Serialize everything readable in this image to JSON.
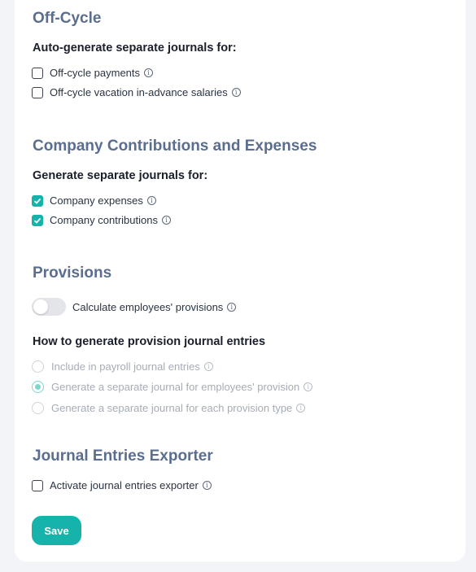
{
  "sections": {
    "off_cycle": {
      "title": "Off-Cycle",
      "subtitle": "Auto-generate separate journals for:",
      "items": [
        {
          "label": "Off-cycle payments",
          "checked": false
        },
        {
          "label": "Off-cycle vacation in-advance salaries",
          "checked": false
        }
      ]
    },
    "contributions": {
      "title": "Company Contributions and Expenses",
      "subtitle": "Generate separate journals for:",
      "items": [
        {
          "label": "Company expenses",
          "checked": true
        },
        {
          "label": "Company contributions",
          "checked": true
        }
      ]
    },
    "provisions": {
      "title": "Provisions",
      "toggle_label": "Calculate employees' provisions",
      "toggle_on": false,
      "subtitle": "How to generate provision journal entries",
      "options": [
        {
          "label": "Include in payroll journal entries",
          "selected": false
        },
        {
          "label": "Generate a separate journal for employees' provision",
          "selected": true
        },
        {
          "label": "Generate a separate journal for each provision type",
          "selected": false
        }
      ]
    },
    "exporter": {
      "title": "Journal Entries Exporter",
      "items": [
        {
          "label": "Activate journal entries exporter",
          "checked": false
        }
      ]
    }
  },
  "actions": {
    "save_label": "Save"
  },
  "colors": {
    "accent": "#15b3a9",
    "heading": "#5b6e8f"
  },
  "icons": {
    "info": "info-icon",
    "check": "check-icon"
  }
}
